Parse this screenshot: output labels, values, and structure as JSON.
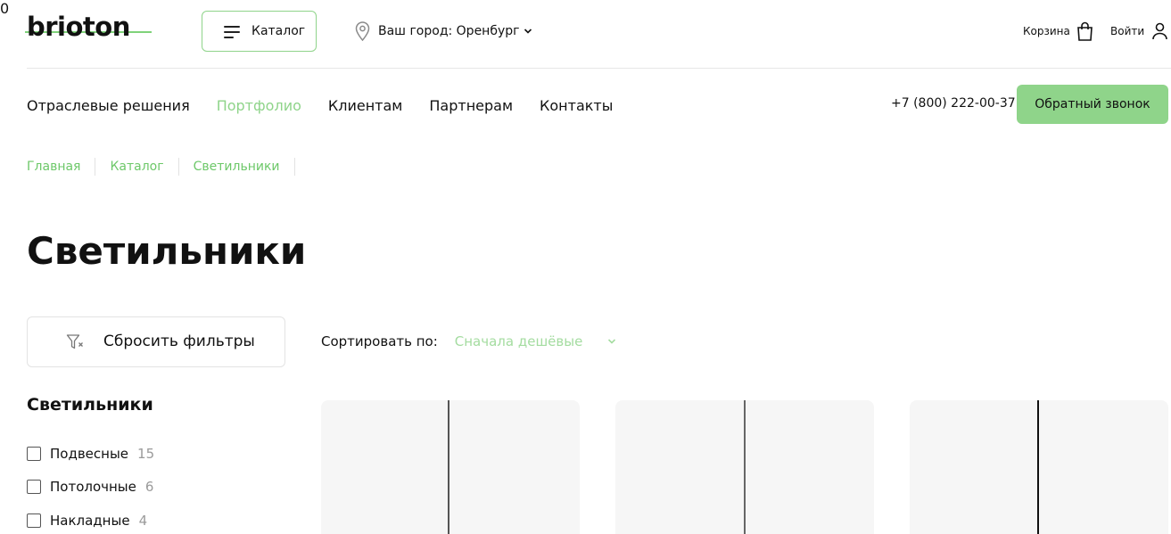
{
  "header": {
    "logo": "brioton",
    "catalog_label": "Каталог",
    "city_label": "Ваш город: Оренбург",
    "cart_label": "Корзина",
    "cart_count": "0",
    "login_label": "Войти"
  },
  "nav": {
    "items": [
      {
        "label": "Отраслевые решения",
        "active": false
      },
      {
        "label": "Портфолио",
        "active": true
      },
      {
        "label": "Клиентам",
        "active": false
      },
      {
        "label": "Партнерам",
        "active": false
      },
      {
        "label": "Контакты",
        "active": false
      }
    ],
    "phone": "+7 (800) 222-00-37",
    "callback_label": "Обратный звонок"
  },
  "breadcrumb": [
    "Главная",
    "Каталог",
    "Светильники"
  ],
  "page_title": "Светильники",
  "sidebar": {
    "reset_label": "Сбросить фильтры",
    "heading": "Светильники",
    "filters": [
      {
        "label": "Подвесные",
        "count": "15",
        "checked": false
      },
      {
        "label": "Потолочные",
        "count": "6",
        "checked": false
      },
      {
        "label": "Накладные",
        "count": "4",
        "checked": false
      }
    ]
  },
  "sort": {
    "label": "Сортировать по:",
    "value": "Сначала дешёвые"
  },
  "colors": {
    "accent": "#8fd48a",
    "link": "#6dc869",
    "card_bg": "#f6f6f6"
  },
  "products": [
    {
      "icon": "pendant-cord"
    },
    {
      "icon": "pendant-cord"
    },
    {
      "icon": "pendant-cord"
    }
  ]
}
